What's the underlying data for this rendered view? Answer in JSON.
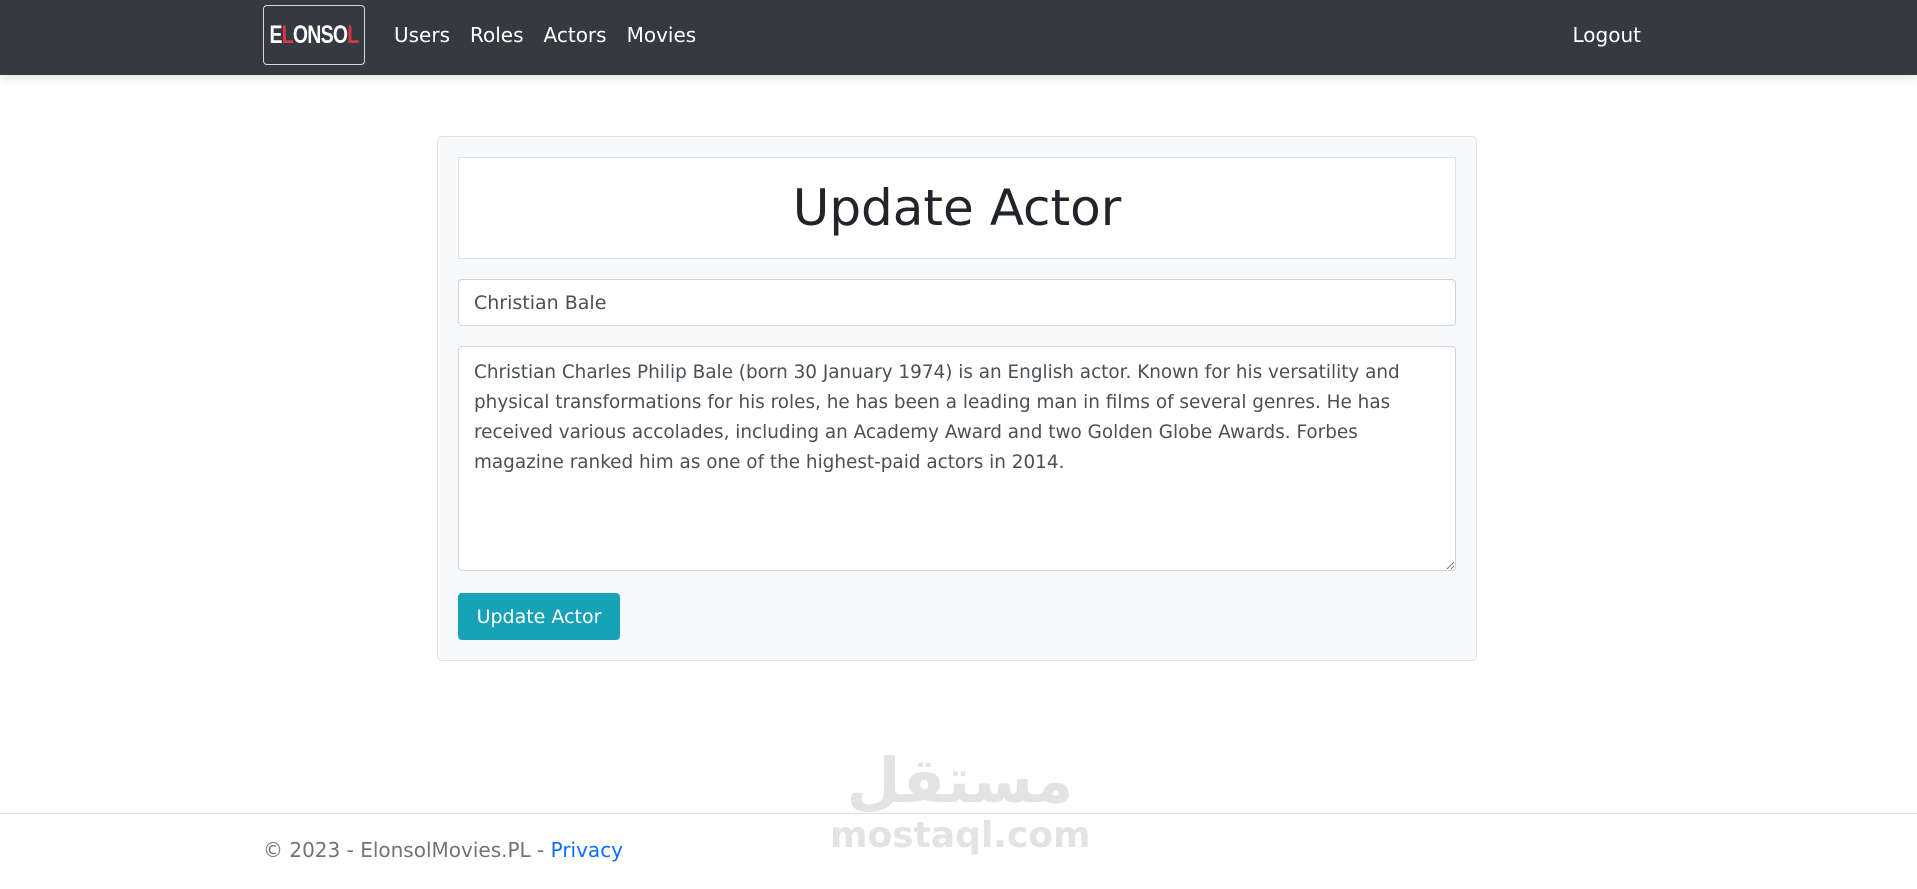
{
  "navbar": {
    "brand": {
      "part1": "E",
      "part2": "L",
      "part3": "ONSO",
      "part4": "L"
    },
    "links": [
      {
        "label": "Users"
      },
      {
        "label": "Roles"
      },
      {
        "label": "Actors"
      },
      {
        "label": "Movies"
      }
    ],
    "logout_label": "Logout"
  },
  "form": {
    "title": "Update Actor",
    "name_value": "Christian Bale",
    "bio_value": "Christian Charles Philip Bale (born 30 January 1974) is an English actor. Known for his versatility and physical transformations for his roles, he has been a leading man in films of several genres. He has received various accolades, including an Academy Award and two Golden Globe Awards. Forbes magazine ranked him as one of the highest-paid actors in 2014.",
    "submit_label": "Update Actor"
  },
  "watermark": {
    "arabic": "مستقل",
    "latin": "mostaql.com"
  },
  "footer": {
    "text": "© 2023 - ElonsolMovies.PL - ",
    "privacy_label": "Privacy"
  },
  "colors": {
    "navbar_bg": "#343a40",
    "accent_button": "#17a2b8",
    "brand_red": "#dc3545",
    "link_blue": "#0d6efd"
  }
}
